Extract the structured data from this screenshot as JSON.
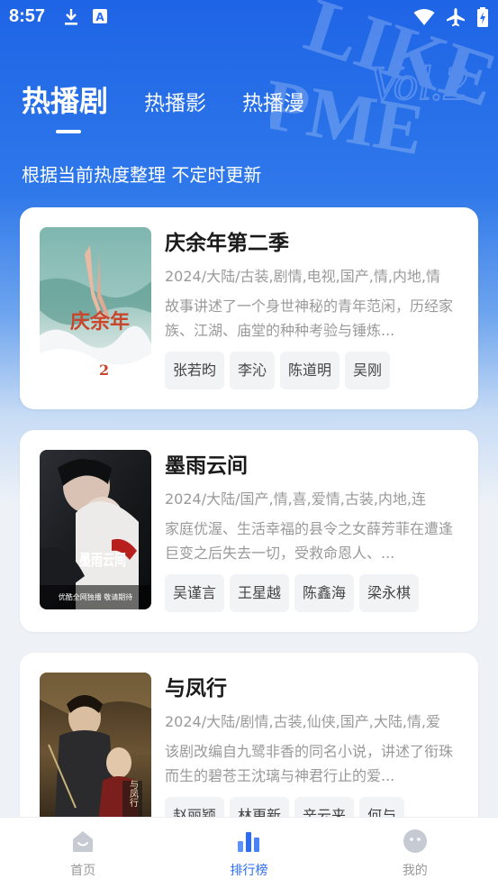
{
  "status_bar": {
    "time": "8:57",
    "left_icons": [
      "download-icon",
      "keyboard-a-icon"
    ],
    "right_icons": [
      "wifi-icon",
      "airplane-icon",
      "battery-charging-icon"
    ]
  },
  "tabs": [
    {
      "label": "热播剧",
      "active": true
    },
    {
      "label": "热播影",
      "active": false
    },
    {
      "label": "热播漫",
      "active": false
    }
  ],
  "subtitle": "根据当前热度整理 不定时更新",
  "cards": [
    {
      "title": "庆余年第二季",
      "meta": "2024/大陆/古装,剧情,电视,国产,情,内地,情",
      "desc": "故事讲述了一个身世神秘的青年范闲，历经家族、江湖、庙堂的种种考验与锤炼...",
      "tags": [
        "张若昀",
        "李沁",
        "陈道明",
        "吴刚"
      ],
      "poster_text": "庆余年",
      "poster_sub": "2"
    },
    {
      "title": "墨雨云间",
      "meta": "2024/大陆/国产,情,喜,爱情,古装,内地,连",
      "desc": "家庭优渥、生活幸福的县令之女薛芳菲在遭逢巨变之后失去一切，受救命恩人、...",
      "tags": [
        "吴谨言",
        "王星越",
        "陈鑫海",
        "梁永棋"
      ],
      "poster_text": "墨雨云间",
      "poster_sub": "优酷全网独播 敬请期待"
    },
    {
      "title": "与凤行",
      "meta": "2024/大陆/剧情,古装,仙侠,国产,大陆,情,爱",
      "desc": "该剧改编自九鹭非香的同名小说，讲述了衔珠而生的碧苍王沈璃与神君行止的爱...",
      "tags": [
        "赵丽颖",
        "林更新",
        "辛云来",
        "何与"
      ],
      "poster_text": "与凤行",
      "poster_sub": ""
    }
  ],
  "bottom_nav": [
    {
      "label": "首页",
      "icon": "home-icon",
      "active": false
    },
    {
      "label": "排行榜",
      "icon": "ranking-icon",
      "active": true
    },
    {
      "label": "我的",
      "icon": "profile-icon",
      "active": false
    }
  ],
  "colors": {
    "accent": "#2a6df4",
    "header_blue": "#1e64e6",
    "muted_text": "#9a9a9a"
  }
}
